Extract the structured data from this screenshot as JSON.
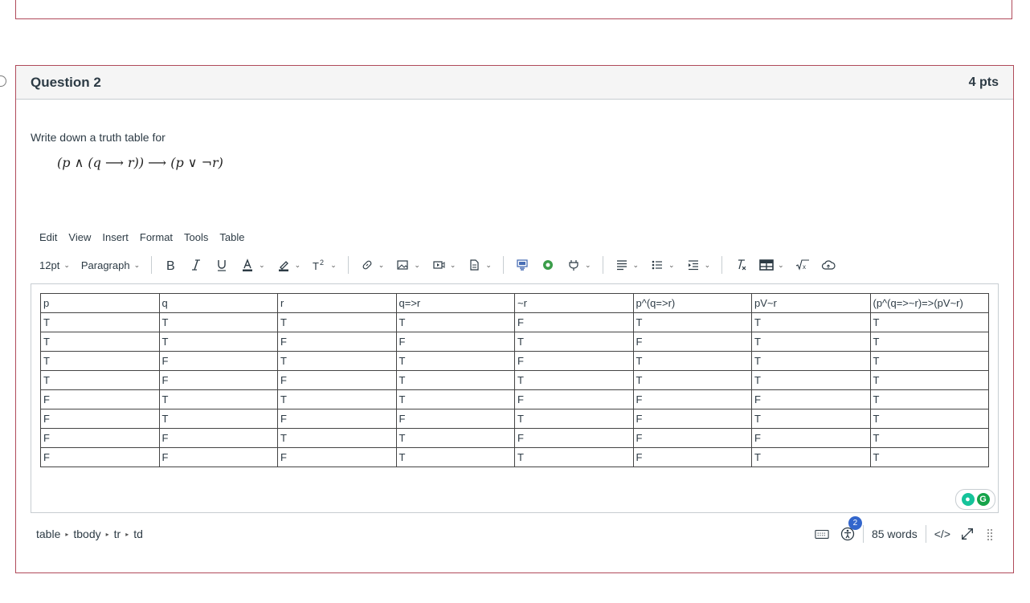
{
  "question": {
    "title": "Question 2",
    "points": "4 pts",
    "prompt": "Write down a truth table for",
    "formula": "(p ∧ (q ⟶ r)) ⟶ (p ∨ ¬r)"
  },
  "menubar": [
    "Edit",
    "View",
    "Insert",
    "Format",
    "Tools",
    "Table"
  ],
  "toolbar": {
    "font_size": "12pt",
    "block_format": "Paragraph"
  },
  "table": {
    "headers": [
      "p",
      "q",
      "r",
      "q=>r",
      "~r",
      "p^(q=>r)",
      "pV~r",
      "(p^(q=>~r)=>(pV~r)"
    ],
    "rows": [
      [
        "T",
        "T",
        "T",
        "T",
        "F",
        "T",
        "T",
        "T"
      ],
      [
        "T",
        "T",
        "F",
        "F",
        "T",
        "F",
        "T",
        "T"
      ],
      [
        "T",
        "F",
        "T",
        "T",
        "F",
        "T",
        "T",
        "T"
      ],
      [
        "T",
        "F",
        "F",
        "T",
        "T",
        "T",
        "T",
        "T"
      ],
      [
        "F",
        "T",
        "T",
        "T",
        "F",
        "F",
        "F",
        "T"
      ],
      [
        "F",
        "T",
        "F",
        "F",
        "T",
        "F",
        "T",
        "T"
      ],
      [
        "F",
        "F",
        "T",
        "T",
        "F",
        "F",
        "F",
        "T"
      ],
      [
        "F",
        "F",
        "F",
        "T",
        "T",
        "F",
        "T",
        "T"
      ]
    ]
  },
  "statusbar": {
    "path": [
      "table",
      "tbody",
      "tr",
      "td"
    ],
    "accessibility_badge": "2",
    "word_count": "85 words",
    "html_toggle": "</>"
  },
  "colors": {
    "border_accent": "#b04a5a",
    "header_bg": "#f5f5f5",
    "badge": "#3366cc",
    "grammarly_green": "#15c39a"
  }
}
